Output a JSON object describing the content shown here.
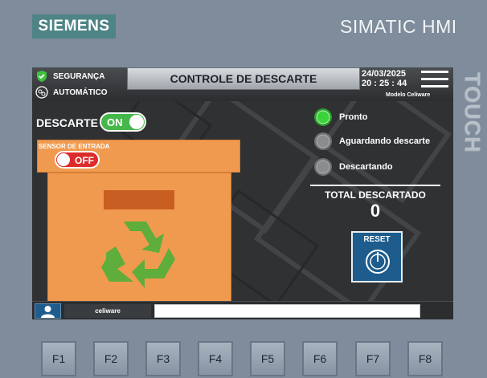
{
  "panel": {
    "logo": "SIEMENS",
    "brand": "SIMATIC HMI",
    "touch_label": "TOUCH"
  },
  "status": {
    "security": "SEGURANÇA",
    "mode": "AUTOMÁTICO"
  },
  "header": {
    "title": "CONTROLE DE DESCARTE",
    "date": "24/03/2025",
    "time": "20 : 25 : 44",
    "model": "Modelo Celiware"
  },
  "descarte": {
    "label": "DESCARTE",
    "toggle": "ON"
  },
  "sensor": {
    "label": "SENSOR DE ENTRADA",
    "toggle": "OFF"
  },
  "states": [
    {
      "label": "Pronto",
      "color": "#3bd23b"
    },
    {
      "label": "Aguardando descarte",
      "color": "#8a8d90"
    },
    {
      "label": "Descartando",
      "color": "#8a8d90"
    }
  ],
  "total": {
    "label": "TOTAL DESCARTADO",
    "value": "0"
  },
  "reset": {
    "label": "RESET"
  },
  "footer": {
    "user": "celiware"
  },
  "fkeys": [
    "F1",
    "F2",
    "F3",
    "F4",
    "F5",
    "F6",
    "F7",
    "F8"
  ],
  "colors": {
    "accent_green": "#46b74a",
    "box_orange": "#f09a4f",
    "button_blue": "#1d5c8c",
    "alarm_red": "#dd2b2b"
  }
}
